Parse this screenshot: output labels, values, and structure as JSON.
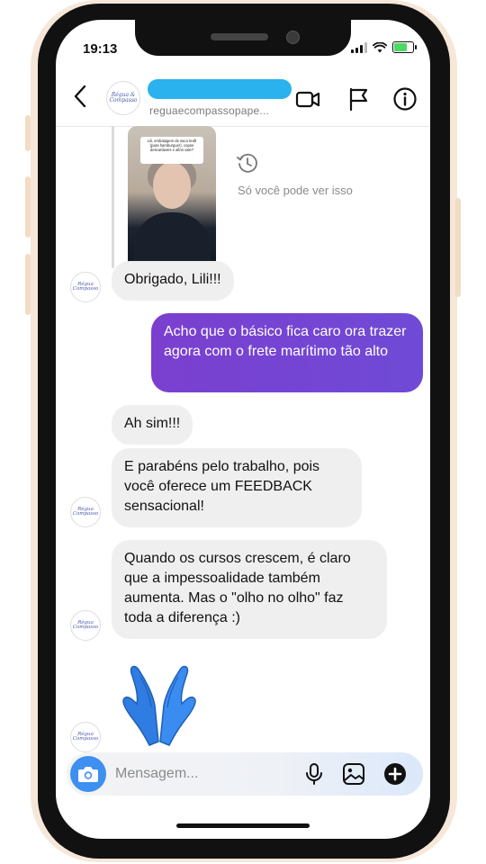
{
  "status_bar": {
    "time": "19:13"
  },
  "header": {
    "avatar_text": "Régua & Compasso",
    "handle": "reguaecompassopape...",
    "icons": [
      "back-chevron-icon",
      "video-call-icon",
      "flag-icon",
      "info-icon"
    ]
  },
  "story_reply": {
    "card_text": "Lili, embalagem de saco kraft (para hamburguer), copos descartáveis e afins vale?",
    "note": "Só você pode ver isso"
  },
  "messages": [
    {
      "side": "in",
      "text": "Obrigado,  Lili!!!"
    },
    {
      "side": "out",
      "text": "Acho que o básico fica caro ora trazer agora com o frete marítimo tão alto"
    },
    {
      "side": "in",
      "text": "Ah sim!!!"
    },
    {
      "side": "in",
      "text": "E parabéns pelo trabalho, pois você oferece um FEEDBACK sensacional!"
    },
    {
      "side": "in",
      "text": "Quando os cursos crescem, é claro que a impessoalidade também aumenta. Mas o \"olho no olho\" faz toda a diferença :)"
    },
    {
      "side": "in",
      "emoji": "🙏"
    }
  ],
  "avatar_label": "Régua Compasso",
  "composer": {
    "placeholder": "Mensagem...",
    "icons": [
      "camera-icon",
      "microphone-icon",
      "gallery-icon",
      "plus-circle-icon"
    ]
  },
  "colors": {
    "accent": "#3d8ff0",
    "outgoing_bubble": "#7045d4",
    "incoming_bubble": "#efefef",
    "name_redaction": "#29b2ee"
  }
}
